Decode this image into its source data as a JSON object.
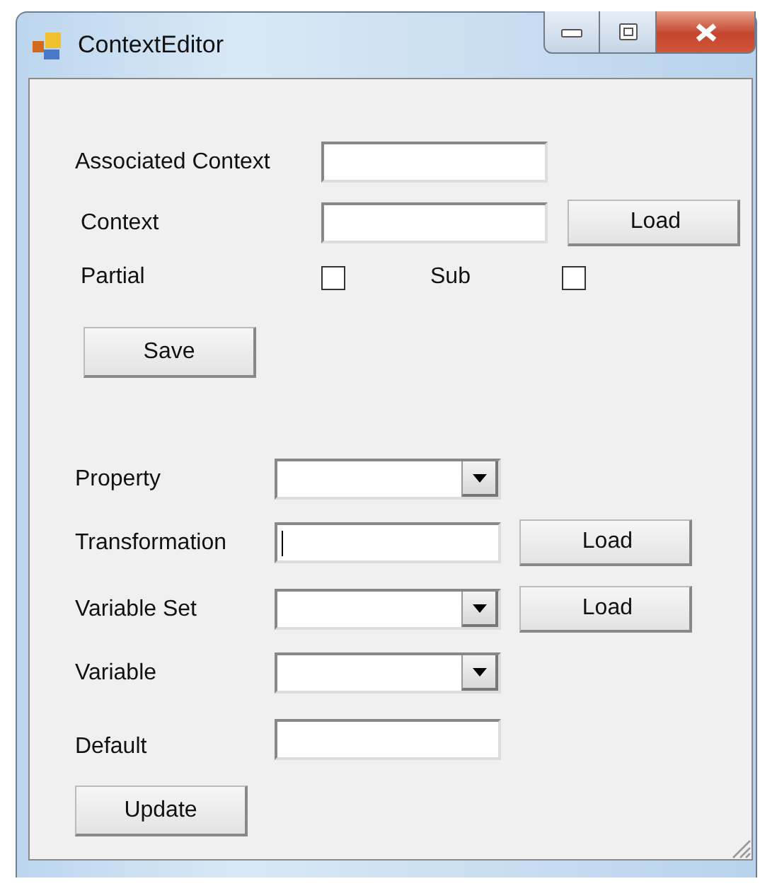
{
  "window": {
    "title": "ContextEditor"
  },
  "context_section": {
    "rows": [
      {
        "kind": "text_field",
        "label": "Associated Context",
        "focused": false
      },
      {
        "kind": "text_field",
        "label": "Context",
        "focused": false,
        "button": "Load"
      },
      {
        "kind": "checks",
        "checks": [
          {
            "label": "Partial",
            "checked": false
          },
          {
            "label": "Sub",
            "checked": false
          }
        ]
      },
      {
        "kind": "button",
        "button": "Save"
      }
    ]
  },
  "property_section": {
    "rows": [
      {
        "kind": "dropdown",
        "label": "Property",
        "focused": false
      },
      {
        "kind": "text_field",
        "label": "Transformation",
        "focused": true,
        "button": "Load"
      },
      {
        "kind": "dropdown",
        "label": "Variable Set",
        "focused": false,
        "button": "Load"
      },
      {
        "kind": "dropdown",
        "label": "Variable",
        "focused": false
      },
      {
        "kind": "text_field",
        "label": "Default",
        "focused": false
      },
      {
        "kind": "button",
        "button": "Update"
      }
    ]
  }
}
